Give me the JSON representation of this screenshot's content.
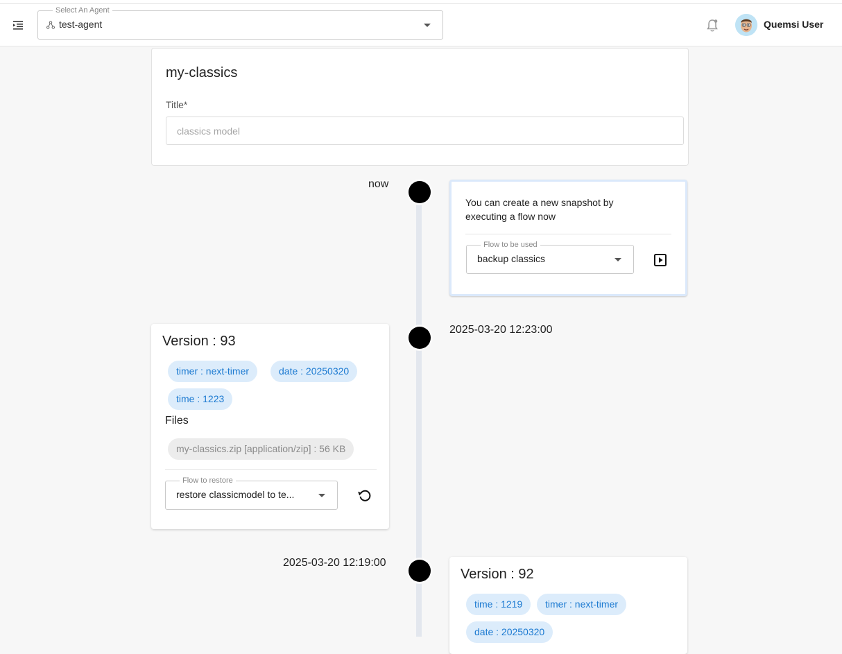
{
  "appbar": {
    "agent_select": {
      "legend": "Select An Agent",
      "value": "test-agent"
    },
    "user": {
      "name": "Quemsi User"
    },
    "icons": [
      "menu-collapse-icon",
      "agent-icon",
      "bell-icon",
      "avatar"
    ]
  },
  "model": {
    "name": "my-classics",
    "title_label": "Title*",
    "title_placeholder": "classics model"
  },
  "timeline": {
    "now": {
      "time": "now",
      "message": "You can create a new snapshot by executing a flow now",
      "flow_legend": "Flow to be used",
      "flow_value": "backup classics",
      "run_icon": "play-box-icon"
    },
    "versions": [
      {
        "time": "2025-03-20 12:23:00",
        "title": "Version : 93",
        "tags": [
          "timer : next-timer",
          "date : 20250320",
          "time : 1223"
        ],
        "files_heading": "Files",
        "files": [
          "my-classics.zip [application/zip] : 56 KB"
        ],
        "restore_legend": "Flow to restore",
        "restore_value": "restore classicmodel to te...",
        "restore_icon": "restore-icon"
      },
      {
        "time": "2025-03-20 12:19:00",
        "title": "Version : 92",
        "tags": [
          "time : 1219",
          "timer : next-timer",
          "date : 20250320"
        ]
      }
    ]
  },
  "colors": {
    "chip_tag_bg": "#dcecfb",
    "chip_tag_text": "#1c7ad1",
    "chip_file_bg": "#ececec",
    "timeline_line": "#e3e7ee",
    "dot": "#000000"
  }
}
